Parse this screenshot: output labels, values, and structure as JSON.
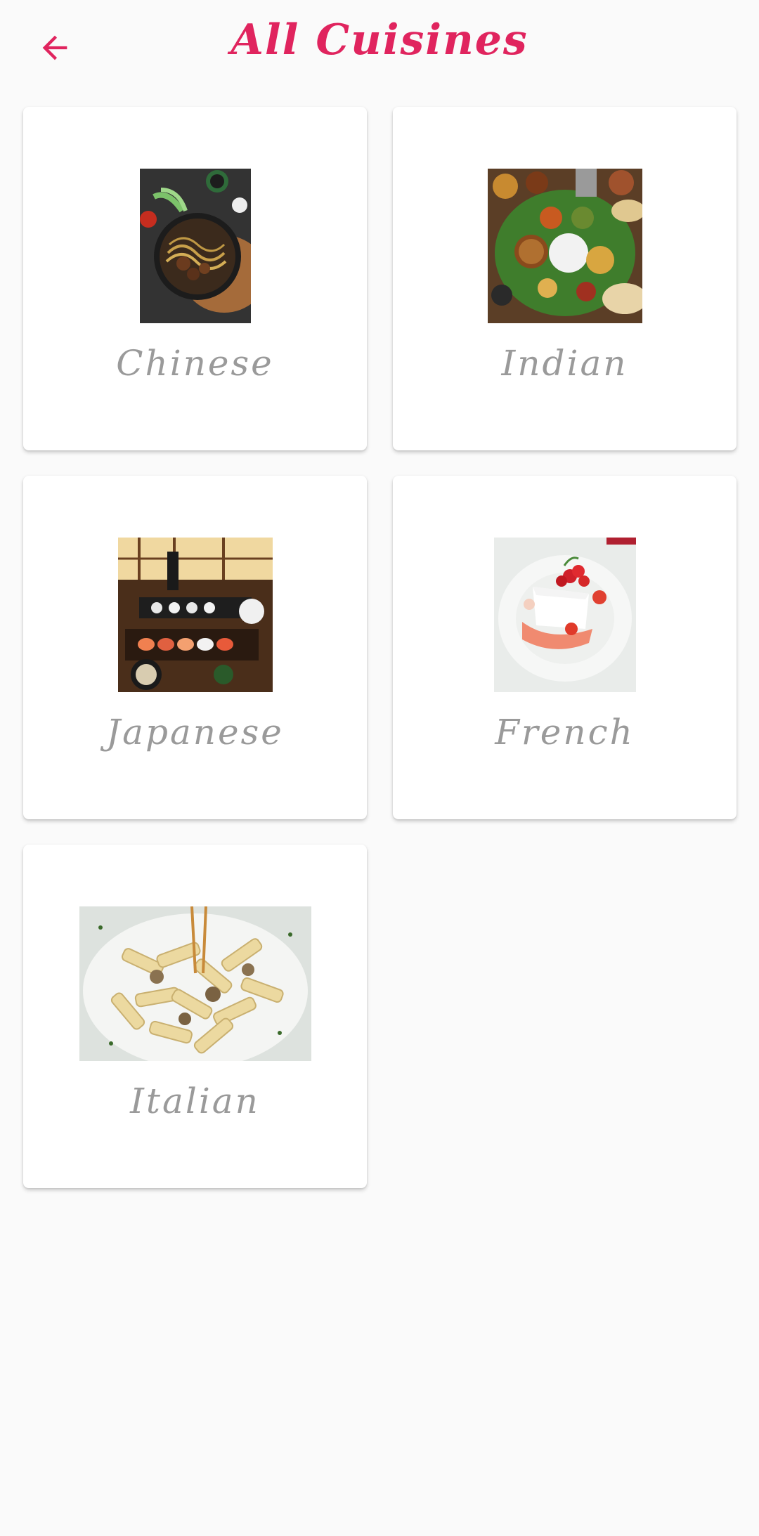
{
  "header": {
    "title": "All Cuisines",
    "back_icon": "arrow-left-icon",
    "accent_color": "#e0245e"
  },
  "cuisines": [
    {
      "label": "Chinese",
      "image": "chinese-noodles-photo"
    },
    {
      "label": "Indian",
      "image": "indian-thali-photo"
    },
    {
      "label": "Japanese",
      "image": "japanese-sushi-spread-photo"
    },
    {
      "label": "French",
      "image": "french-dessert-photo"
    },
    {
      "label": "Italian",
      "image": "italian-penne-pasta-photo"
    }
  ]
}
